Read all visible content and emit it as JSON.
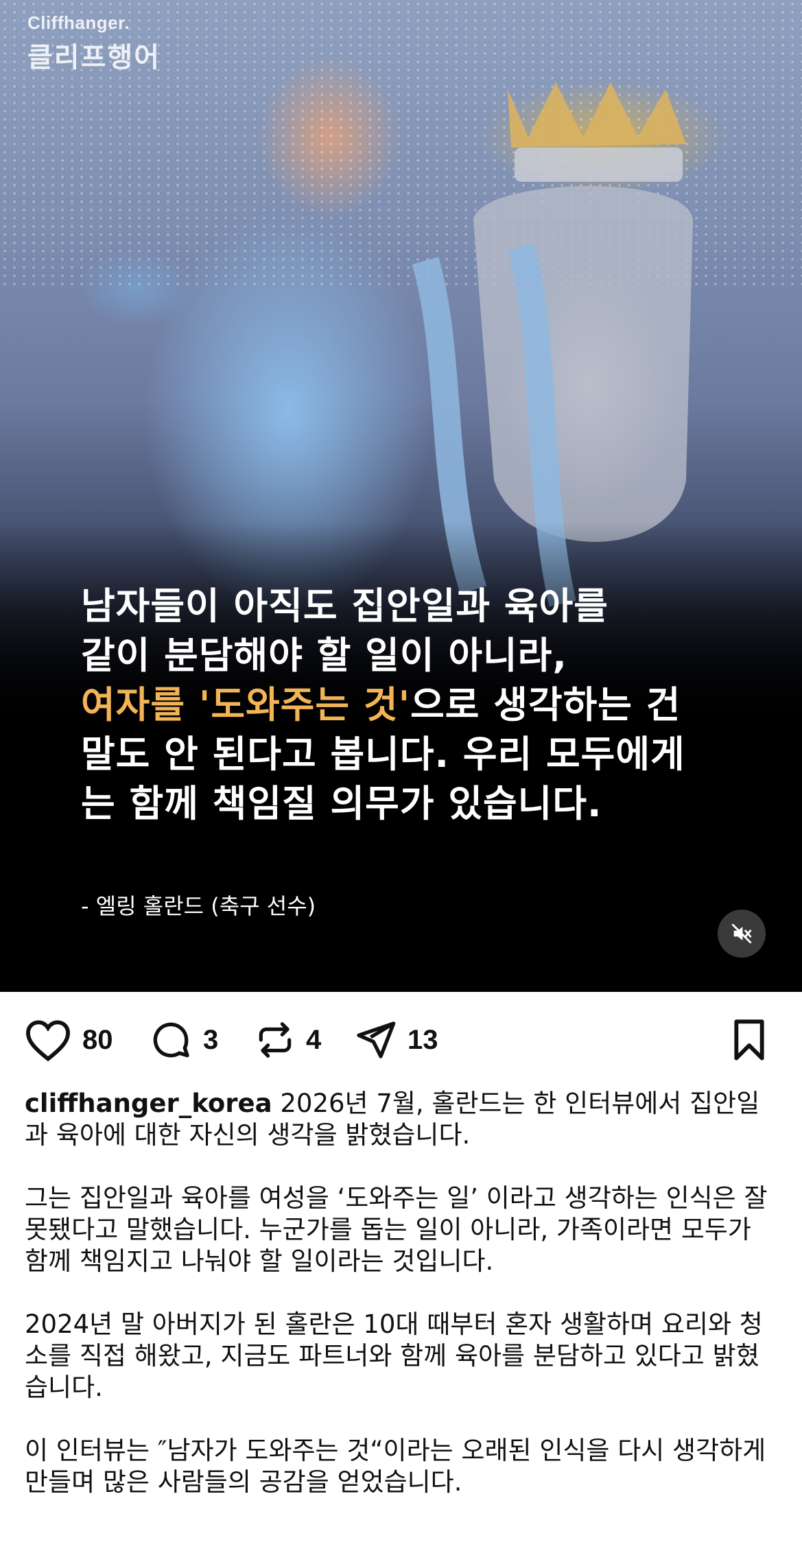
{
  "post": {
    "logo_en": "Cliffhanger.",
    "logo_ko": "클리프행어",
    "quote_line1": "남자들이 아직도 집안일과 육아를",
    "quote_line2": "같이 분담해야 할 일이 아니라,",
    "quote_highlight": "여자를 '도와주는 것'",
    "quote_line3_rest": "으로 생각하는 건",
    "quote_line4": "말도 안 된다고 봅니다. 우리 모두에게",
    "quote_line5": "는 함께 책임질 의무가 있습니다.",
    "attribution": "- 엘링 홀란드 (축구 선수)",
    "highlight_color": "#f2b457"
  },
  "actions": {
    "like_count": "80",
    "comment_count": "3",
    "repost_count": "4",
    "share_count": "13"
  },
  "caption": {
    "username": "cliffhanger_korea",
    "para1_text": "2026년 7월, 홀란드는 한 인터뷰에서 집안일과 육아에 대한 자신의 생각을 밝혔습니다.",
    "para2": "그는 집안일과 육아를 여성을 ‘도와주는 일’ 이라고 생각하는 인식은 잘못됐다고 말했습니다. 누군가를 돕는 일이 아니라, 가족이라면 모두가 함께 책임지고 나눠야 할 일이라는 것입니다.",
    "para3": "2024년 말 아버지가 된 홀란은 10대 때부터 혼자 생활하며 요리와 청소를 직접 해왔고, 지금도 파트너와 함께 육아를 분담하고 있다고 밝혔습니다.",
    "para4": "이 인터뷰는 ″남자가 도와주는 것“이라는 오래된 인식을 다시 생각하게 만들며 많은 사람들의 공감을 얻었습니다."
  }
}
